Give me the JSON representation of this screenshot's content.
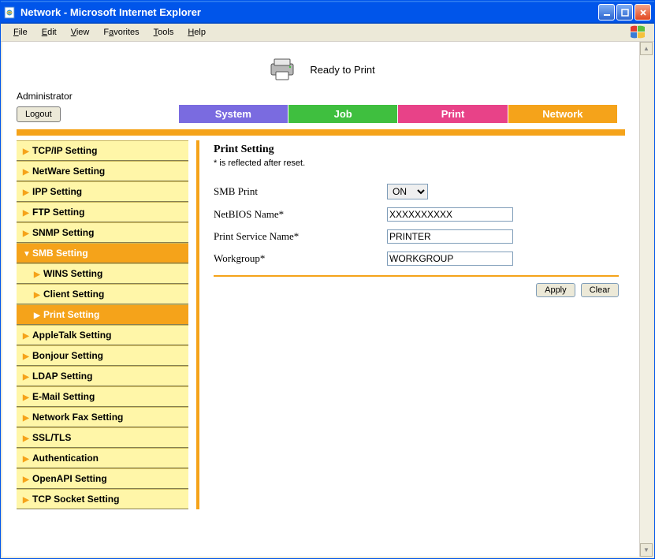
{
  "window": {
    "title": "Network - Microsoft Internet Explorer"
  },
  "menubar": {
    "file": "File",
    "edit": "Edit",
    "view": "View",
    "favorites": "Favorites",
    "tools": "Tools",
    "help": "Help"
  },
  "status": {
    "text": "Ready to Print"
  },
  "admin_label": "Administrator",
  "logout_label": "Logout",
  "tabs": {
    "system": "System",
    "job": "Job",
    "print": "Print",
    "network": "Network"
  },
  "sidebar": {
    "tcpip": "TCP/IP Setting",
    "netware": "NetWare Setting",
    "ipp": "IPP Setting",
    "ftp": "FTP Setting",
    "snmp": "SNMP Setting",
    "smb": "SMB Setting",
    "smb_children": {
      "wins": "WINS Setting",
      "client": "Client Setting",
      "print": "Print Setting"
    },
    "appletalk": "AppleTalk Setting",
    "bonjour": "Bonjour Setting",
    "ldap": "LDAP Setting",
    "email": "E-Mail Setting",
    "networkfax": "Network Fax Setting",
    "ssltls": "SSL/TLS",
    "auth": "Authentication",
    "openapi": "OpenAPI Setting",
    "tcpsocket": "TCP Socket Setting"
  },
  "panel": {
    "title": "Print Setting",
    "note": "* is reflected after reset.",
    "fields": {
      "smb_print_label": "SMB Print",
      "smb_print_value": "ON",
      "netbios_label": "NetBIOS Name*",
      "netbios_value": "XXXXXXXXXX",
      "service_label": "Print Service Name*",
      "service_value": "PRINTER",
      "workgroup_label": "Workgroup*",
      "workgroup_value": "WORKGROUP"
    },
    "apply_label": "Apply",
    "clear_label": "Clear"
  }
}
